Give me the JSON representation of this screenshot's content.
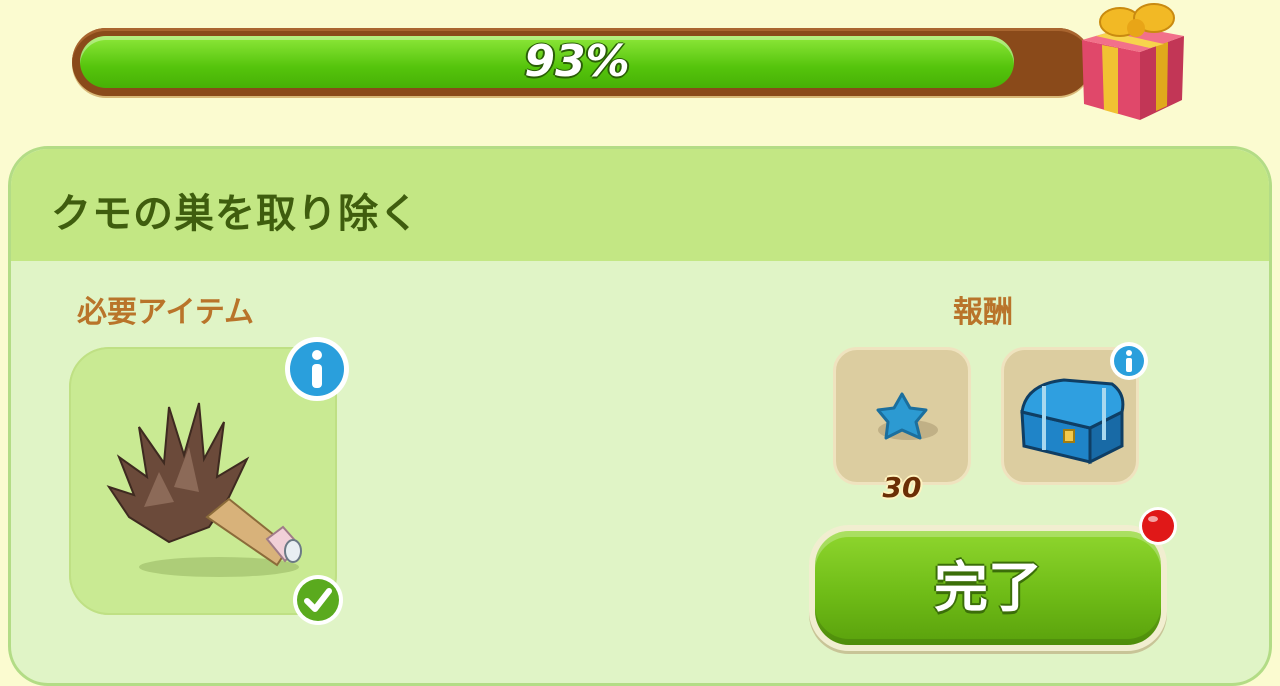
{
  "progress": {
    "label": "93%",
    "fraction": 0.93
  },
  "quest": {
    "title": "クモの巣を取り除く"
  },
  "required": {
    "label": "必要アイテム",
    "item_icon": "feather-duster-icon"
  },
  "rewards": {
    "label": "報酬",
    "items": [
      {
        "icon": "blue-star-icon",
        "count": "30"
      },
      {
        "icon": "treasure-chest-icon"
      }
    ]
  },
  "complete_button": {
    "label": "完了"
  },
  "colors": {
    "progress_green": "#55c40c",
    "track_brown": "#8a4a1a",
    "panel_bg": "#e0f4c6",
    "header_bg": "#c3e784",
    "title_text": "#3f5d0e",
    "label_text": "#b9742a",
    "button_green": "#6fbc17"
  }
}
